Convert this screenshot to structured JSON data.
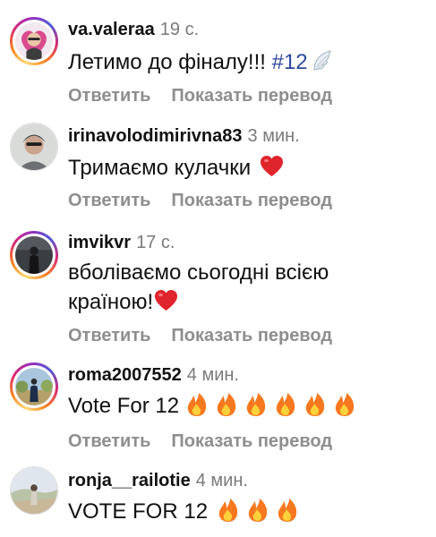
{
  "comments": [
    {
      "username": "va.valeraa",
      "time": "19 с.",
      "text": "Летимо до фіналу!!!",
      "hashtag": "#12",
      "emoji": "wing",
      "reply_label": "Ответить",
      "translate_label": "Показать перевод"
    },
    {
      "username": "irinavolodimirivna83",
      "time": "3 мин.",
      "text": "Тримаємо кулачки",
      "emoji": "red-heart",
      "reply_label": "Ответить",
      "translate_label": "Показать перевод"
    },
    {
      "username": "imvikvr",
      "time": "17 с.",
      "text_line1": "вболіваємо сьогодні всією",
      "text_line2": "країною!",
      "emoji": "red-heart",
      "reply_label": "Ответить",
      "translate_label": "Показать перевод"
    },
    {
      "username": "roma2007552",
      "time": "4 мин.",
      "text": "Vote For 12",
      "emoji": "fire",
      "emoji_count": 6,
      "reply_label": "Ответить",
      "translate_label": "Показать перевод"
    },
    {
      "username": "ronja__railotie",
      "time": "4 мин.",
      "text": "VOTE FOR 12",
      "emoji": "fire",
      "emoji_count": 3
    }
  ],
  "colors": {
    "text": "#111111",
    "muted": "#8e8e8e",
    "hashtag": "#2e4a9e",
    "heart": "#e0242c",
    "fire": "#f7781e"
  }
}
